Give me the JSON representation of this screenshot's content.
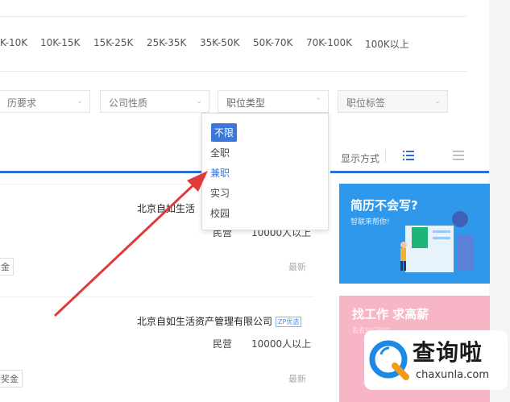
{
  "salary_ranges": [
    "K-10K",
    "10K-15K",
    "15K-25K",
    "25K-35K",
    "35K-50K",
    "50K-70K",
    "70K-100K",
    "100K以上"
  ],
  "filters": {
    "education": "历要求",
    "company_type": "公司性质",
    "position_type": "职位类型",
    "position_tags": "职位标签"
  },
  "dropdown": {
    "items": [
      "不限",
      "全职",
      "兼职",
      "实习",
      "校园"
    ],
    "selected": "不限",
    "highlighted": "兼职"
  },
  "view": {
    "label": "显示方式",
    "list_icon": "list-icon",
    "grid_icon": "grid-icon"
  },
  "jobs": [
    {
      "company": "北京自如生活",
      "type": "民营",
      "size": "10000人以上",
      "latest": "最新",
      "tag": "金"
    },
    {
      "company": "北京自如生活资产管理有限公司",
      "badge": "ZP优选",
      "type": "民营",
      "size": "10000人以上",
      "latest": "最新",
      "tag": "奖金"
    }
  ],
  "ads": [
    {
      "title": "简历不会写?",
      "sub": "智联来帮你!"
    },
    {
      "title": "找工作 求高薪",
      "sub": "看看热门职位"
    }
  ],
  "watermark": {
    "cn": "查询啦",
    "en": "chaxunla.com"
  },
  "colors": {
    "accent": "#2f6dd6",
    "arrow": "#e03a3a",
    "ad_blue": "#2f98ea",
    "ad_pink": "#f7b5c6"
  }
}
